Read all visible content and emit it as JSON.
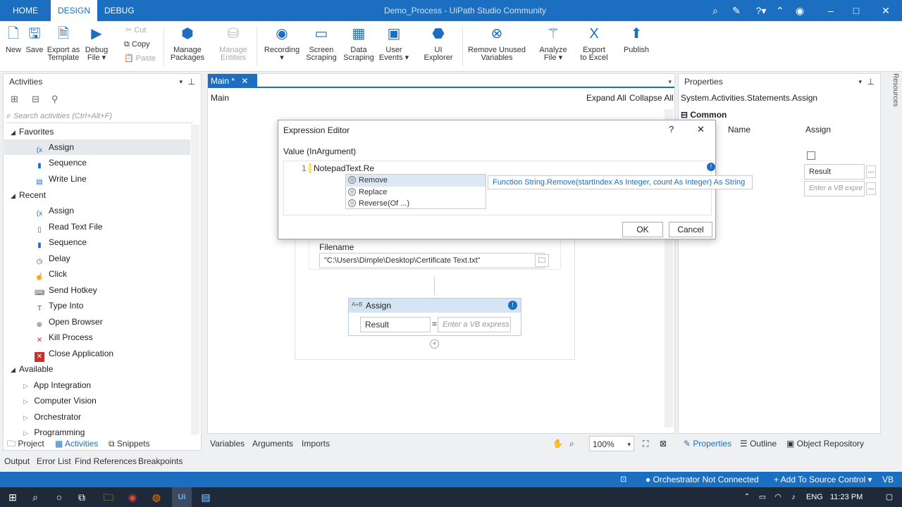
{
  "titlebar": {
    "tabs": [
      "HOME",
      "DESIGN",
      "DEBUG"
    ],
    "active_tab": "DESIGN",
    "window_title": "Demo_Process - UiPath Studio Community"
  },
  "ribbon": {
    "new": "New",
    "save": "Save",
    "export_template": [
      "Export as",
      "Template"
    ],
    "debug_file": [
      "Debug",
      "File ▾"
    ],
    "cut": "Cut",
    "copy": "Copy",
    "paste": "Paste",
    "manage_packages": [
      "Manage",
      "Packages"
    ],
    "manage_entities": [
      "Manage",
      "Entities"
    ],
    "recording": [
      "Recording",
      "▾"
    ],
    "screen_scraping": [
      "Screen",
      "Scraping"
    ],
    "data_scraping": [
      "Data",
      "Scraping"
    ],
    "user_events": [
      "User",
      "Events ▾"
    ],
    "ui_explorer": [
      "UI",
      "Explorer"
    ],
    "remove_unused": [
      "Remove Unused",
      "Variables"
    ],
    "analyze_file": [
      "Analyze",
      "File ▾"
    ],
    "export_excel": [
      "Export",
      "to Excel"
    ],
    "publish": "Publish"
  },
  "activities": {
    "header": "Activities",
    "search_placeholder": "Search activities (Ctrl+Alt+F)",
    "favorites_label": "Favorites",
    "favorites": [
      "Assign",
      "Sequence",
      "Write Line"
    ],
    "recent_label": "Recent",
    "recent": [
      "Assign",
      "Read Text File",
      "Sequence",
      "Delay",
      "Click",
      "Send Hotkey",
      "Type Into",
      "Open Browser",
      "Kill Process",
      "Close Application"
    ],
    "available_label": "Available",
    "available": [
      "App Integration",
      "Computer Vision",
      "Orchestrator",
      "Programming"
    ],
    "bottom_tabs": [
      "Project",
      "Activities",
      "Snippets"
    ]
  },
  "designer": {
    "tab": "Main *",
    "breadcrumb": "Main",
    "expand_all": "Expand All",
    "collapse_all": "Collapse All",
    "filename_label": "Filename",
    "filename_value": "\"C:\\Users\\Dimple\\Desktop\\Certificate Text.txt\"",
    "assign_title": "Assign",
    "assign_to": "Result",
    "assign_eq": "=",
    "assign_value_placeholder": "Enter a VB express",
    "bottom_tabs": [
      "Variables",
      "Arguments",
      "Imports"
    ],
    "zoom": "100%"
  },
  "properties": {
    "header": "Properties",
    "type": "System.Activities.Statements.Assign",
    "section": "Common",
    "col_name": "Name",
    "col_value": "Assign",
    "result": "Result",
    "value_placeholder": "Enter a VB expre",
    "bottom_tabs": [
      "Properties",
      "Outline",
      "Object Repository"
    ],
    "side_label": "Resources"
  },
  "output_tabs": [
    "Output",
    "Error List",
    "Find References",
    "Breakpoints"
  ],
  "dialog": {
    "title": "Expression Editor",
    "help": "?",
    "close": "✕",
    "label": "Value (InArgument)",
    "line_no": "1",
    "code": "NotepadText.Re",
    "suggestions": [
      "Remove",
      "Replace",
      "Reverse(Of ...)"
    ],
    "tooltip": "Function String.Remove(startIndex As Integer, count As Integer) As String",
    "ok": "OK",
    "cancel": "Cancel"
  },
  "statusbar": {
    "orchestrator": "Orchestrator Not Connected",
    "source_control": "+ Add To Source Control ▾",
    "lang": "VB"
  },
  "taskbar": {
    "lang": "ENG",
    "time": "11:23 PM"
  }
}
